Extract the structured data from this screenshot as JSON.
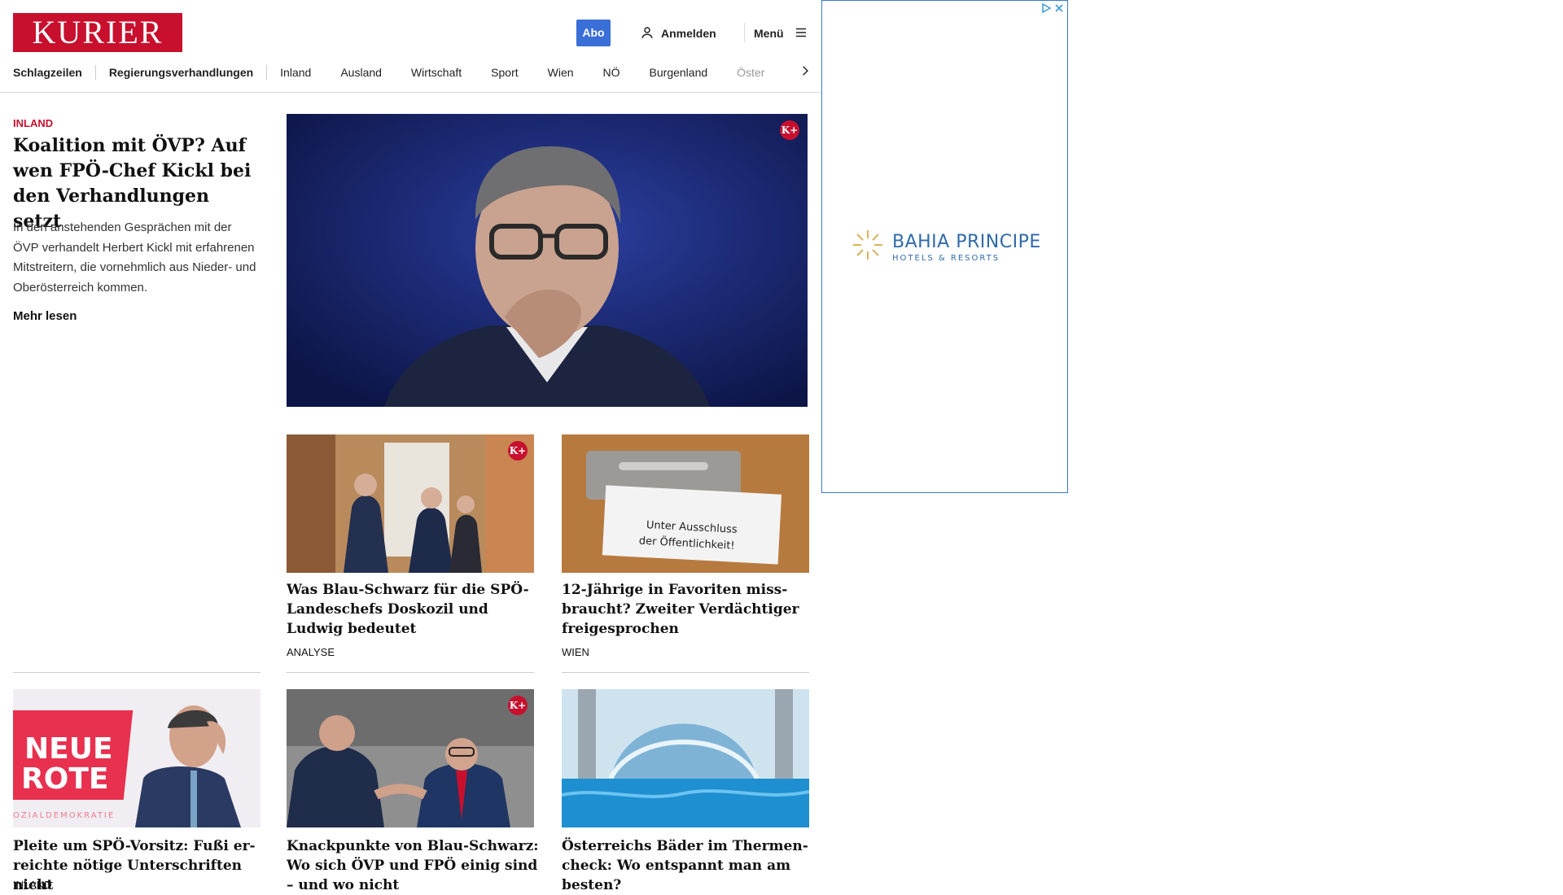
{
  "header": {
    "logo_text": "KURIER",
    "abo_label": "Abo",
    "login_label": "Anmelden",
    "menu_label": "Menü"
  },
  "nav": {
    "items": [
      "Schlagzeilen",
      "Regierungsverhandlungen",
      "Inland",
      "Ausland",
      "Wirtschaft",
      "Sport",
      "Wien",
      "NÖ",
      "Burgenland",
      "Öster"
    ]
  },
  "lead": {
    "category": "INLAND",
    "title": "Koalition mit ÖVP? Auf wen FPÖ-Chef Kickl bei den Verhandlungen setzt",
    "teaser": "In den anstehenden Gesprächen mit der ÖVP verhandelt Herbert Kickl mit erfahrenen Mitstreitern, die vornehmlich aus Nieder- und Oberösterreich kommen.",
    "more_label": "Mehr lesen",
    "premium_badge": "K+"
  },
  "cards": [
    {
      "title": "Was Blau-Schwarz für die SPÖ-Landeschefs Doskozil und Ludwig bedeutet",
      "tag": "ANALYSE",
      "premium_badge": "K+"
    },
    {
      "title": "12-Jährige in Favoriten miss­braucht? Zweiter Verdächtiger freigesprochen",
      "tag": "WIEN",
      "image_text_1": "Unter Ausschluss",
      "image_text_2": "der Öffentlichkeit!"
    },
    {
      "title": "Pleite um SPÖ-Vorsitz: Fußi er­reichte nötige Unterschriften nicht",
      "tag": "INLAND",
      "image_text_1": "NEUE",
      "image_text_2": "ROTE",
      "image_text_3": "OZIALDEMOKRATIE"
    },
    {
      "title": "Knackpunkte von Blau-Schwarz: Wo sich ÖVP und FPÖ einig sind – und wo nicht",
      "tag": "",
      "premium_badge": "K+"
    },
    {
      "title": "Österreichs Bäder im Thermen­check: Wo entspannt man am besten?",
      "tag": ""
    }
  ],
  "ad": {
    "brand": "BAHIA PRINCIPE",
    "subtitle": "HOTELS & RESORTS"
  },
  "colors": {
    "brand_red": "#c8102e",
    "abo_blue": "#3a6fd8",
    "ad_border": "#3a78c9"
  }
}
